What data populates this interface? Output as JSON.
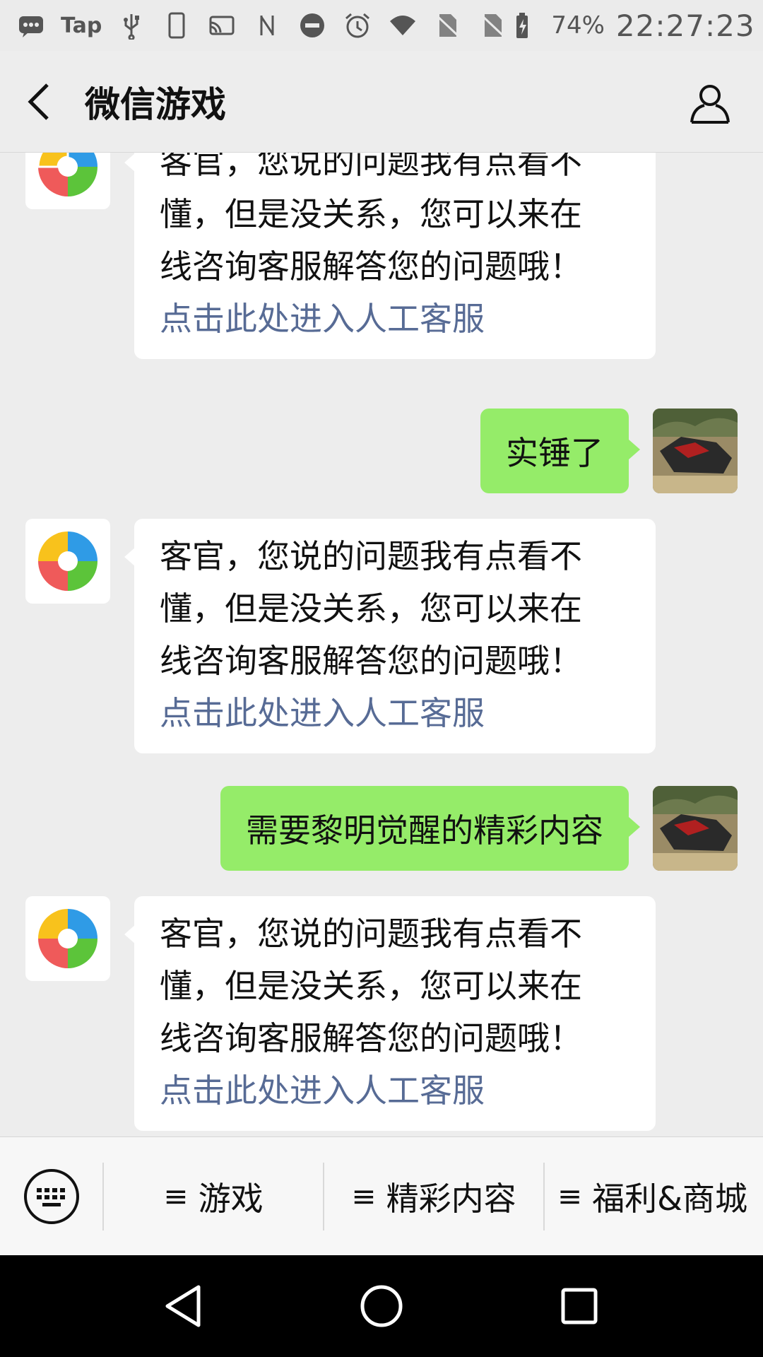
{
  "status_bar": {
    "tap_label": "Tap",
    "battery": "74%",
    "time": "22:27:23",
    "icons": [
      "message-icon",
      "usb-icon",
      "phone-icon",
      "cast-icon",
      "nfc-icon",
      "dnd-icon",
      "alarm-icon",
      "wifi-icon",
      "no-sim-icon",
      "no-sim-icon",
      "battery-icon"
    ]
  },
  "header": {
    "title": "微信游戏",
    "back_icon": "chevron-left-icon",
    "profile_icon": "person-icon"
  },
  "messages": [
    {
      "sender": "bot",
      "lines": [
        "客官，您说的问题我有点看不",
        "懂，但是没关系，您可以来在",
        "线咨询客服解答您的问题哦！"
      ],
      "link": "点击此处进入人工客服"
    },
    {
      "sender": "user",
      "text": "实锤了"
    },
    {
      "sender": "bot",
      "lines": [
        "客官，您说的问题我有点看不",
        "懂，但是没关系，您可以来在",
        "线咨询客服解答您的问题哦！"
      ],
      "link": "点击此处进入人工客服"
    },
    {
      "sender": "user",
      "text": "需要黎明觉醒的精彩内容"
    },
    {
      "sender": "bot",
      "lines": [
        "客官，您说的问题我有点看不",
        "懂，但是没关系，您可以来在",
        "线咨询客服解答您的问题哦！"
      ],
      "link": "点击此处进入人工客服"
    }
  ],
  "menu": {
    "keyboard_icon": "keyboard-icon",
    "items": [
      {
        "icon": "≡",
        "label": "游戏"
      },
      {
        "icon": "≡",
        "label": "精彩内容"
      },
      {
        "icon": "≡",
        "label": "福利&商城"
      }
    ]
  },
  "nav": {
    "icons": [
      "back-triangle-icon",
      "home-circle-icon",
      "recents-square-icon"
    ]
  },
  "colors": {
    "user_bubble": "#95ec69",
    "link": "#576b95",
    "background": "#ededed"
  }
}
